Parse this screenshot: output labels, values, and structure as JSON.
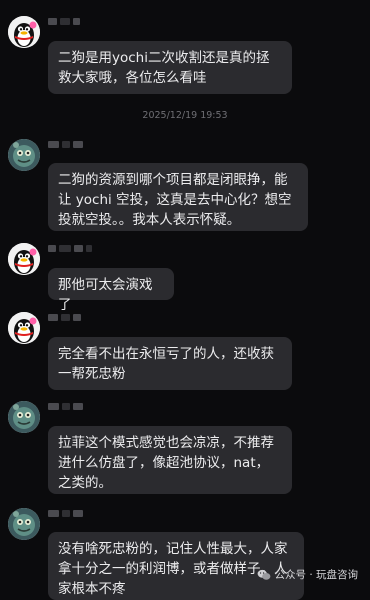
{
  "messages": [
    {
      "avatar": "qq-penguin-avatar",
      "text": "二狗是用yochi二次收割还是真的拯救大家哦，各位怎么看哇"
    },
    {
      "avatar": "cartoon-creature-avatar",
      "text": "二狗的资源到哪个项目都是闭眼挣，能让 yochi 空投，这真是去中心化？想空投就空投。。我本人表示怀疑。"
    },
    {
      "avatar": "qq-penguin-avatar",
      "text": "那他可太会演戏了"
    },
    {
      "avatar": "qq-penguin-avatar",
      "text": "完全看不出在永恒亏了的人，还收获一帮死忠粉"
    },
    {
      "avatar": "cartoon-creature-avatar",
      "text": "拉菲这个模式感觉也会凉凉，不推荐进什么仿盘了，像超池协议，nat，之类的。"
    },
    {
      "avatar": "cartoon-creature-avatar",
      "text": "没有啥死忠粉的，记住人性最大，人家拿十分之一的利润博，或者做样子，人家根本不疼"
    }
  ],
  "timestamp": "2025/12/19 19:53",
  "watermark": {
    "icon": "wechat-icon",
    "text": "公众号 · 玩盘咨询"
  }
}
